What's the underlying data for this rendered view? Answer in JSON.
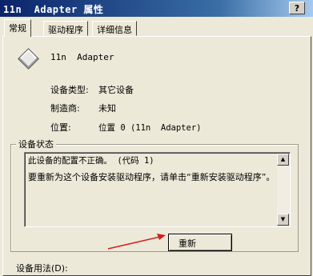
{
  "window": {
    "title": "11n  Adapter 属性",
    "help_label": "?"
  },
  "tabs": [
    {
      "label": "常规",
      "active": true
    },
    {
      "label": "驱动程序",
      "active": false
    },
    {
      "label": "详细信息",
      "active": false
    }
  ],
  "device": {
    "icon": "device-diamond-icon",
    "name": "11n  Adapter",
    "props": [
      {
        "label": "设备类型:",
        "value": "其它设备"
      },
      {
        "label": "制造商:",
        "value": "未知"
      },
      {
        "label": "位置:",
        "value": "位置 0 (11n  Adapter)"
      }
    ]
  },
  "status": {
    "group_label": "设备状态",
    "line1": "此设备的配置不正确。 (代码 1)",
    "line2": "要重新为这个设备安装驱动程序，请单击“重新安装驱动程序”。"
  },
  "reinstall_button": {
    "label": "重新"
  },
  "usage": {
    "label": "设备用法(D):"
  },
  "annotation": {
    "arrow_color": "#d41f1f"
  }
}
